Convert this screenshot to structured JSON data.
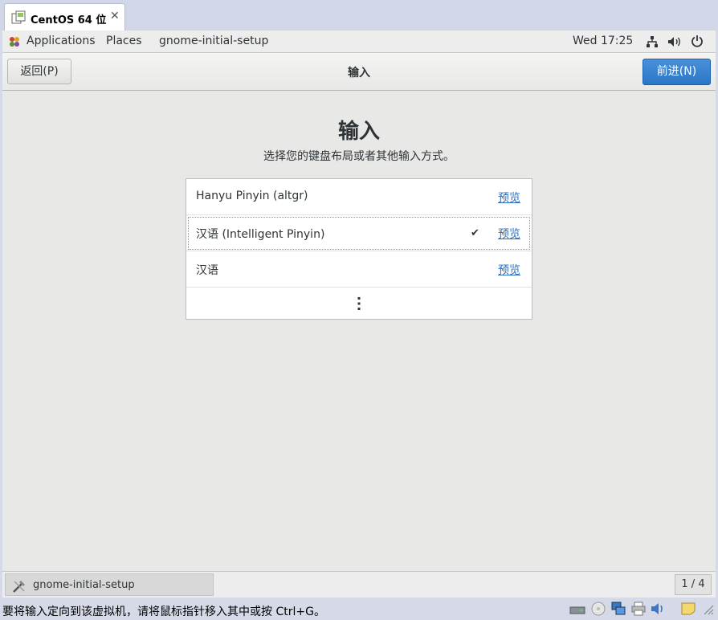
{
  "vm_tab": {
    "title": "CentOS 64 位",
    "close": "✕"
  },
  "topbar": {
    "applications": "Applications",
    "places": "Places",
    "app_name": "gnome-initial-setup",
    "clock": "Wed 17:25"
  },
  "header": {
    "back_label": "返回(P)",
    "title": "输入",
    "next_label": "前进(N)"
  },
  "main": {
    "heading": "输入",
    "subtitle": "选择您的键盘布局或者其他输入方式。",
    "sources": [
      {
        "label": "Hanyu Pinyin (altgr)",
        "selected": false,
        "preview": "预览"
      },
      {
        "label": "汉语 (Intelligent Pinyin)",
        "selected": true,
        "check": "✔",
        "preview": "预览"
      },
      {
        "label": "汉语",
        "selected": false,
        "preview": "预览"
      }
    ]
  },
  "taskbar": {
    "window_label": "gnome-initial-setup",
    "workspace": "1 / 4"
  },
  "statusbar": {
    "message": "要将输入定向到该虚拟机，请将鼠标指针移入其中或按 Ctrl+G。"
  },
  "colors": {
    "accent": "#2a76c6",
    "link": "#2a6ec4",
    "background": "#e8e8e7"
  }
}
